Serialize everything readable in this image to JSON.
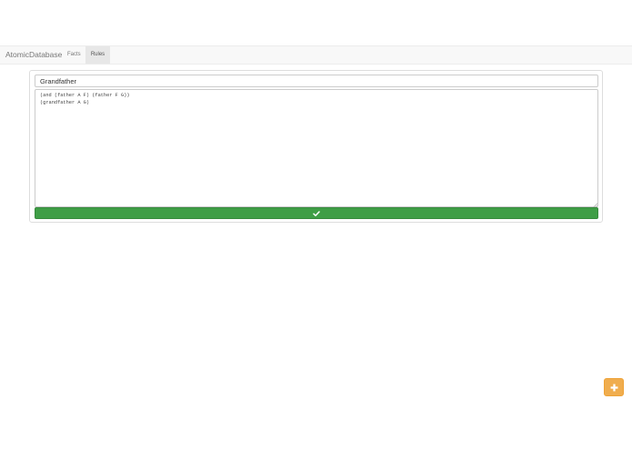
{
  "navbar": {
    "brand": "AtomicDatabase",
    "links": [
      {
        "label": "Facts",
        "active": false
      },
      {
        "label": "Rules",
        "active": true
      }
    ]
  },
  "rule_editor": {
    "title_value": "Grandfather",
    "body_value": "(and (father A F) (father F G))\n(grandfather A G)",
    "save_icon": "check-icon"
  },
  "add_button": {
    "icon": "plus-icon"
  },
  "colors": {
    "navbar_bg": "#f8f8f8",
    "active_tab_bg": "#e7e7e7",
    "success": "#3f9e46",
    "warning": "#f0ad4e"
  }
}
